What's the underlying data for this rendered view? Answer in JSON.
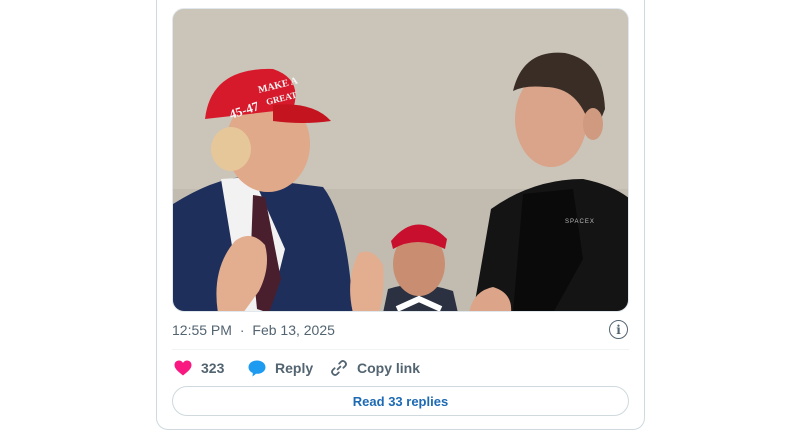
{
  "tweet": {
    "media": {
      "hat_front_text_top": "MAKE A",
      "hat_front_text_mid": "GREAT",
      "hat_side_text": "45-47",
      "shirt_text": "SPACEX"
    },
    "timestamp": {
      "time": "12:55 PM",
      "separator": "·",
      "date": "Feb 13, 2025"
    },
    "actions": {
      "likes_count": "323",
      "reply_label": "Reply",
      "copy_link_label": "Copy link"
    },
    "read_replies_label": "Read 33 replies",
    "colors": {
      "like_pink": "#f91880",
      "reply_blue": "#1d9bf0",
      "link_blue": "#1d6ab4",
      "muted_text": "#536471",
      "border": "#cfd9de"
    },
    "icons": {
      "like": "heart-icon",
      "reply": "speech-bubble-icon",
      "copy": "link-icon",
      "info": "info-icon"
    }
  }
}
